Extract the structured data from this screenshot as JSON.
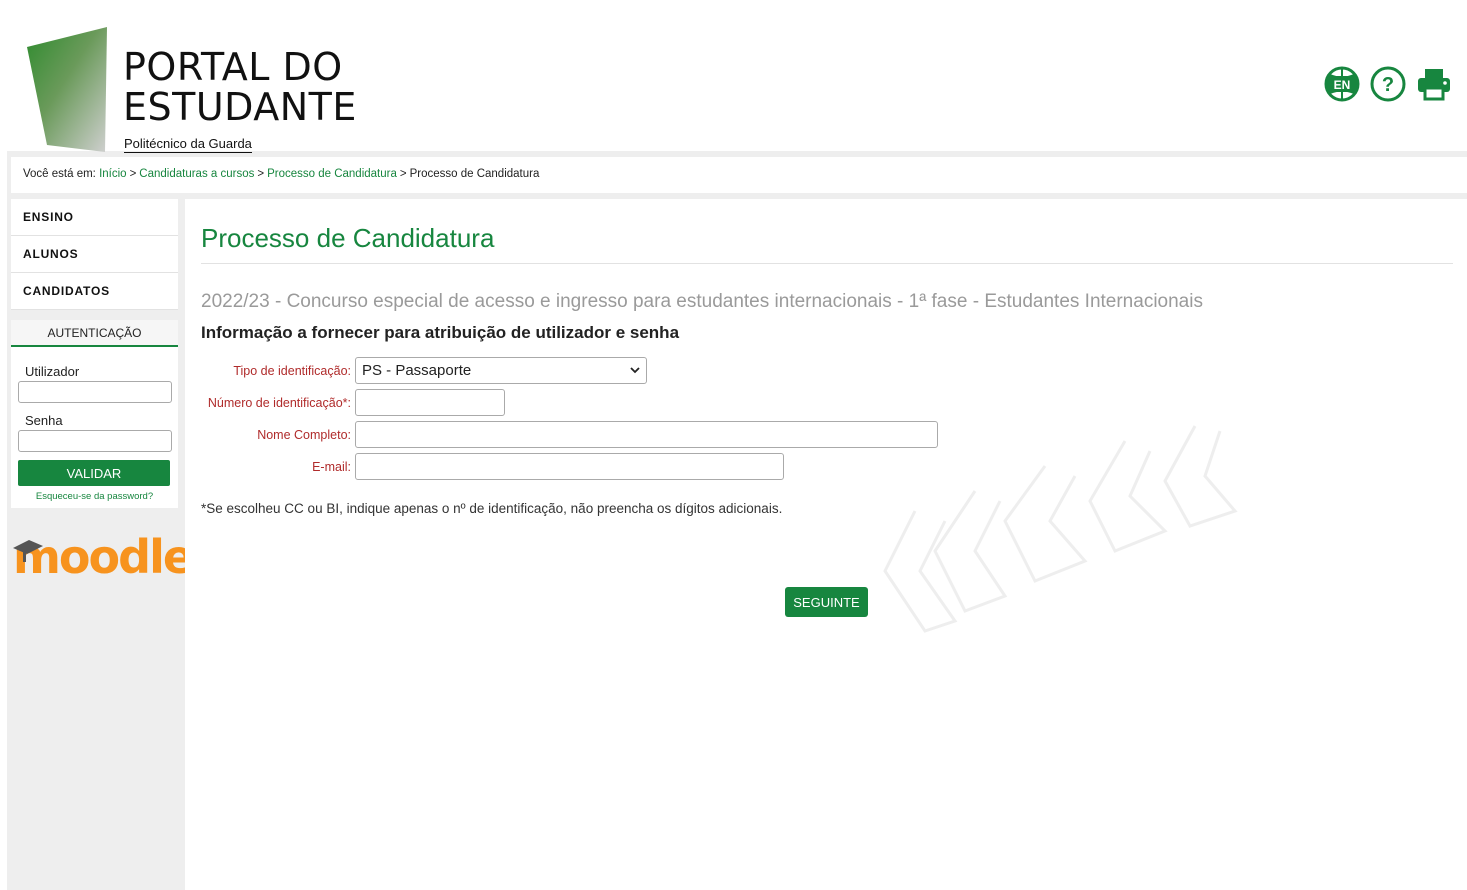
{
  "header": {
    "title_line1": "PORTAL DO",
    "title_line2": "ESTUDANTE",
    "subtitle": "Politécnico da Guarda",
    "language_badge": "EN",
    "icons": [
      "globe-en-icon",
      "help-icon",
      "print-icon"
    ]
  },
  "breadcrumb": {
    "prefix": "Você está em:",
    "items": [
      "Início",
      "Candidaturas a cursos",
      "Processo de Candidatura"
    ],
    "current": "Processo de Candidatura",
    "separator": ">"
  },
  "sidebar": {
    "menu": [
      "ENSINO",
      "ALUNOS",
      "CANDIDATOS"
    ],
    "auth": {
      "heading": "AUTENTICAÇÃO",
      "user_label": "Utilizador",
      "password_label": "Senha",
      "submit_label": "VALIDAR",
      "forgot_label": "Esqueceu-se da password?"
    },
    "moodle_label": "moodle"
  },
  "main": {
    "title": "Processo de Candidatura",
    "subtitle": "2022/23 - Concurso especial de acesso e ingresso para estudantes internacionais - 1ª fase - Estudantes Internacionais",
    "section_title": "Informação a fornecer para atribuição de utilizador e senha",
    "fields": {
      "id_type_label": "Tipo de identificação:",
      "id_type_value": "PS - Passaporte",
      "id_number_label": "Número de identificação*:",
      "full_name_label": "Nome Completo:",
      "email_label": "E-mail:"
    },
    "note": "*Se escolheu CC ou BI, indique apenas o nº de identificação, não preencha os dígitos adicionais.",
    "next_label": "SEGUINTE"
  },
  "colors": {
    "accent_green": "#17863f",
    "label_red": "#b02b2b",
    "moodle_orange": "#f7931e"
  }
}
